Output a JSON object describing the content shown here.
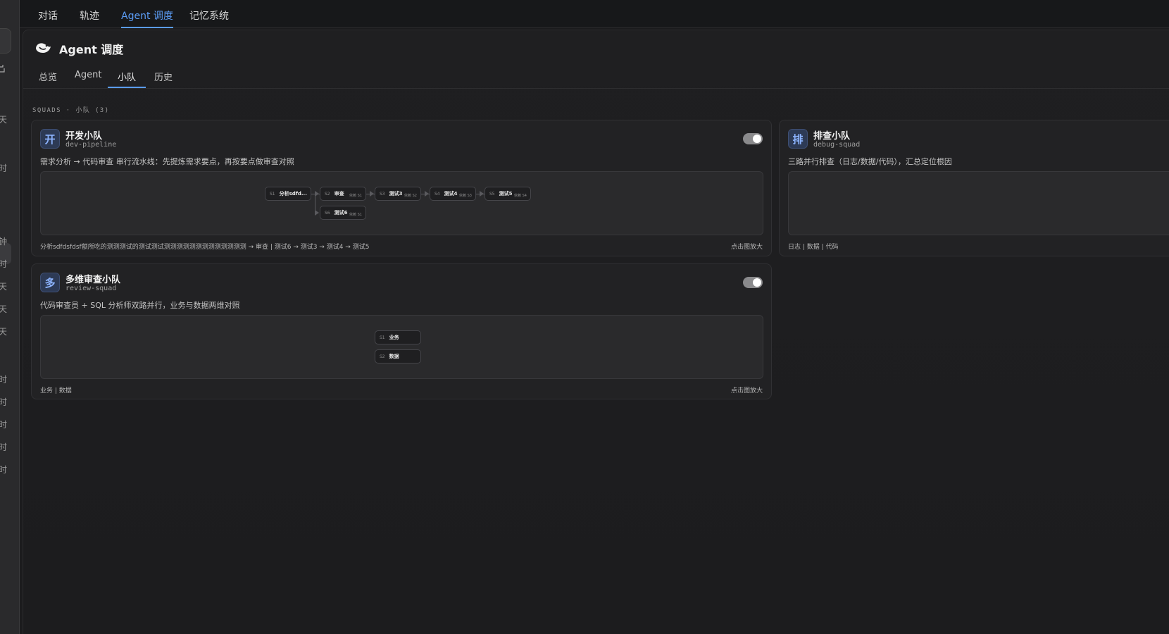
{
  "left_strip": {
    "items": [
      "天",
      "时",
      "钟",
      "时",
      "天",
      "天",
      "天",
      "时",
      "时",
      "时",
      "时",
      "时"
    ]
  },
  "topnav": {
    "tabs": [
      "对话",
      "轨迹",
      "Agent 调度",
      "记忆系统"
    ],
    "active_index": 2
  },
  "panel": {
    "title": "Agent 调度",
    "subtabs": [
      "总览",
      "Agent",
      "小队",
      "历史"
    ],
    "active_subtab": 2,
    "section_label": "SQUADS · 小队 (3)"
  },
  "squads": [
    {
      "avatar": "开",
      "name": "开发小队",
      "slug": "dev-pipeline",
      "description": "需求分析 → 代码审查 串行流水线：先提炼需求要点，再按要点做审查对照",
      "enabled": true,
      "nodes": [
        {
          "id": "S1",
          "label": "分析sdfd...",
          "dep": ""
        },
        {
          "id": "S2",
          "label": "审查",
          "dep": "依赖 S1"
        },
        {
          "id": "S3",
          "label": "测试3",
          "dep": "依赖 S2"
        },
        {
          "id": "S4",
          "label": "测试4",
          "dep": "依赖 S3"
        },
        {
          "id": "S5",
          "label": "测试5",
          "dep": "依赖 S4"
        },
        {
          "id": "S6",
          "label": "测试6",
          "dep": "依赖 S1"
        }
      ],
      "flow": "分析sdfdsfdsf额所吃的测测测试的测试测试测测测测测测测测测测测测测 → 审查 | 测试6 → 测试3 → 测试4 → 测试5",
      "zoom_hint": "点击图放大"
    },
    {
      "avatar": "排",
      "name": "排查小队",
      "slug": "debug-squad",
      "description": "三路并行排查（日志/数据/代码），汇总定位根因",
      "enabled": true,
      "nodes": [],
      "flow": "日志 | 数据 | 代码",
      "zoom_hint": ""
    },
    {
      "avatar": "多",
      "name": "多维审查小队",
      "slug": "review-squad",
      "description": "代码审查员 + SQL 分析师双路并行，业务与数据两维对照",
      "enabled": true,
      "nodes": [
        {
          "id": "S1",
          "label": "业务",
          "dep": ""
        },
        {
          "id": "S2",
          "label": "数据",
          "dep": ""
        }
      ],
      "flow": "业务 | 数据",
      "zoom_hint": "点击图放大"
    }
  ],
  "colors": {
    "accent": "#5b9cf5",
    "background": "#1b1b1d",
    "card": "#222224"
  },
  "icons": {
    "logo": "whale-bird-icon",
    "menu": "menu-icon"
  }
}
